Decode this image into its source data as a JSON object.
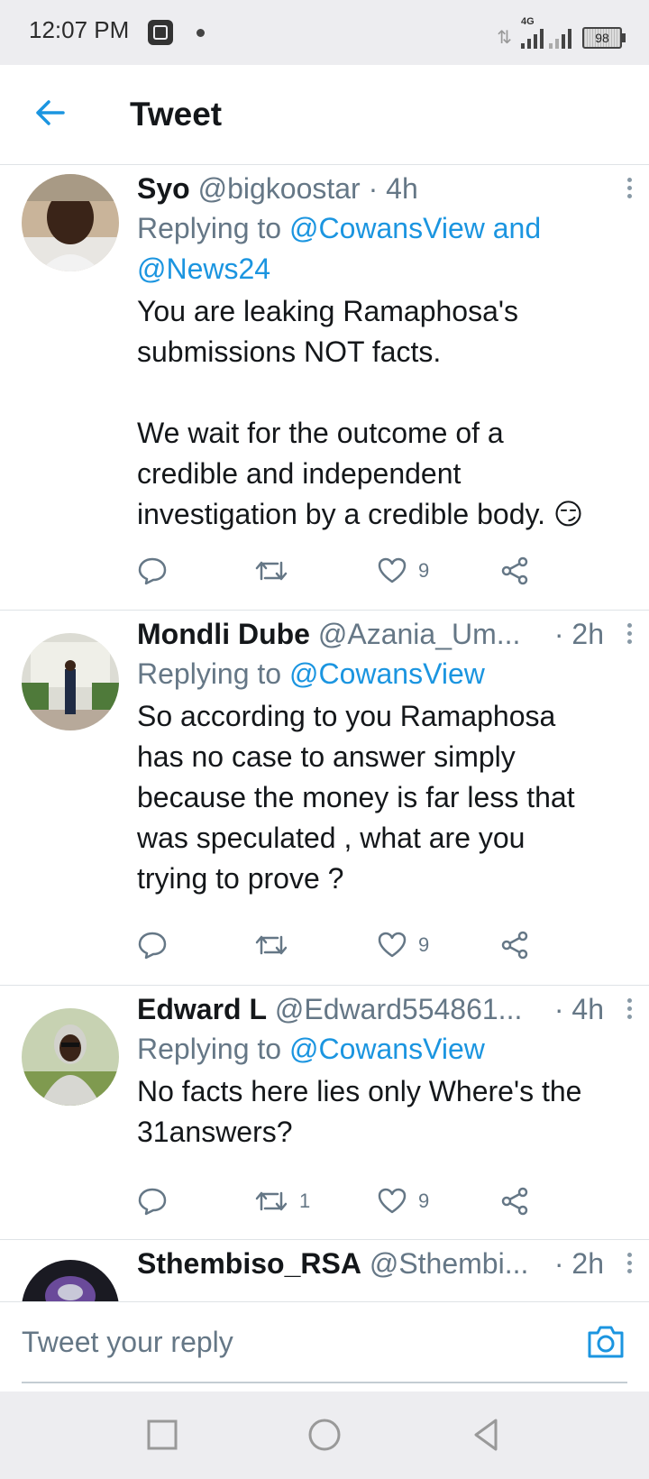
{
  "status_bar": {
    "time": "12:07 PM",
    "network": "4G",
    "battery": "98"
  },
  "header": {
    "title": "Tweet"
  },
  "colors": {
    "accent": "#1b95e0",
    "muted": "#657786",
    "text": "#14171a"
  },
  "tweets": [
    {
      "name": "Syo",
      "handle": "@bigkoostar",
      "time": "· 4h",
      "replying_prefix": "Replying to",
      "replying_line1": "@CowansView and",
      "replying_line2": "@News24",
      "body": "You are leaking Ramaphosa's\nsubmissions NOT facts.\n\nWe wait for the outcome of a\ncredible and independent\ninvestigation by a credible body. 😏",
      "retweets": "",
      "likes": "9"
    },
    {
      "name": "Mondli Dube",
      "handle": "@Azania_Um...",
      "time": "· 2h",
      "replying_prefix": "Replying to",
      "replying_to": "@CowansView",
      "body": "So according to you Ramaphosa\nhas no case to answer simply\nbecause the money is far less that\nwas speculated , what are you\ntrying to prove ?",
      "retweets": "",
      "likes": "9"
    },
    {
      "name": "Edward L",
      "handle": "@Edward554861...",
      "time": "· 4h",
      "replying_prefix": "Replying to",
      "replying_to": "@CowansView",
      "body": "No facts here lies only Where's the\n31answers?",
      "retweets": "1",
      "likes": "9"
    },
    {
      "name": "Sthembiso_RSA",
      "handle": "@Sthembi...",
      "time": "· 2h"
    }
  ],
  "reply_bar": {
    "placeholder": "Tweet your reply"
  },
  "icons": {
    "back": "arrow-left-icon",
    "more": "more-vertical-icon",
    "reply": "comment-icon",
    "retweet": "retweet-icon",
    "like": "heart-icon",
    "share": "share-icon",
    "camera": "camera-icon"
  }
}
